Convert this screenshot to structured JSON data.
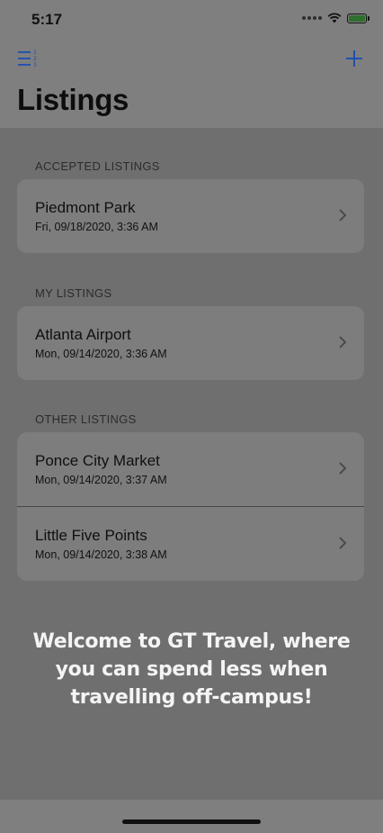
{
  "status_bar": {
    "time": "5:17"
  },
  "nav": {
    "title": "Listings",
    "menu_icon": "list-numbered-icon",
    "add_icon": "plus-icon"
  },
  "sections": [
    {
      "header": "ACCEPTED LISTINGS",
      "items": [
        {
          "name": "Piedmont Park",
          "date": "Fri, 09/18/2020, 3:36 AM"
        }
      ]
    },
    {
      "header": "MY LISTINGS",
      "items": [
        {
          "name": "Atlanta Airport",
          "date": "Mon, 09/14/2020, 3:36 AM"
        }
      ]
    },
    {
      "header": "OTHER LISTINGS",
      "items": [
        {
          "name": "Ponce City Market",
          "date": "Mon, 09/14/2020, 3:37 AM"
        },
        {
          "name": "Little Five Points",
          "date": "Mon, 09/14/2020, 3:38 AM"
        }
      ]
    }
  ],
  "overlay": {
    "line1": "Welcome to GT Travel, where",
    "line2": "you can spend less when",
    "line3": "travelling off-campus!"
  },
  "colors": {
    "accent": "#1f4fb0"
  }
}
